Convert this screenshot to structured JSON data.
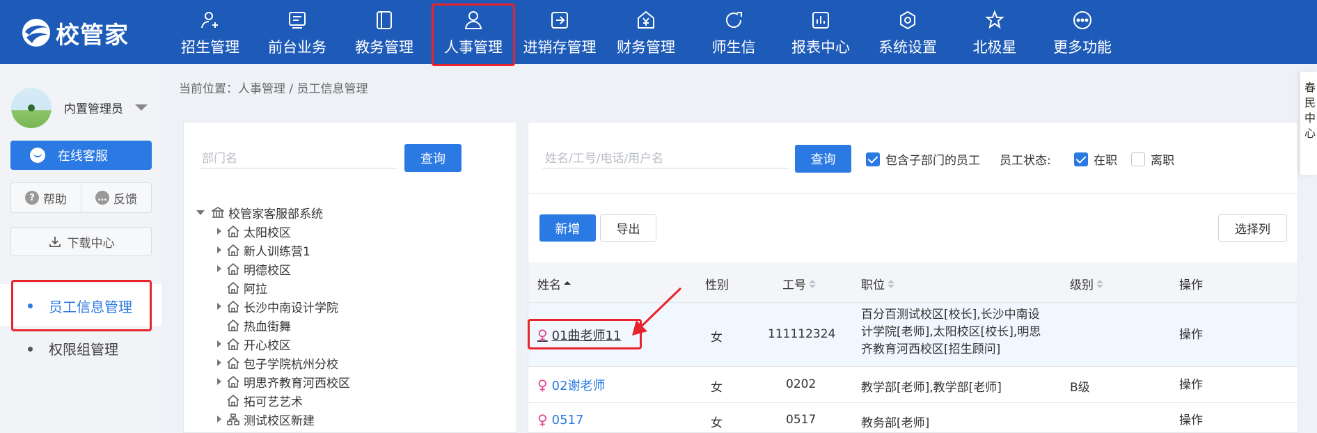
{
  "app": {
    "logo_text": "校管家"
  },
  "nav": [
    {
      "label": "招生管理",
      "icon": "user-plus-icon"
    },
    {
      "label": "前台业务",
      "icon": "monitor-icon"
    },
    {
      "label": "教务管理",
      "icon": "book-icon"
    },
    {
      "label": "人事管理",
      "icon": "person-icon",
      "active": true
    },
    {
      "label": "进销存管理",
      "icon": "inventory-icon"
    },
    {
      "label": "财务管理",
      "icon": "finance-icon"
    },
    {
      "label": "师生信",
      "icon": "message-icon"
    },
    {
      "label": "报表中心",
      "icon": "report-icon"
    },
    {
      "label": "系统设置",
      "icon": "settings-icon"
    },
    {
      "label": "北极星",
      "icon": "star-icon"
    },
    {
      "label": "更多功能",
      "icon": "more-icon"
    }
  ],
  "sidebar": {
    "user_name": "内置管理员",
    "online_service": "在线客服",
    "help": "帮助",
    "feedback": "反馈",
    "download": "下载中心",
    "menu": [
      {
        "label": "员工信息管理",
        "active": true
      },
      {
        "label": "权限组管理",
        "active": false
      }
    ]
  },
  "breadcrumb": "当前位置：人事管理 / 员工信息管理",
  "dept_panel": {
    "search_placeholder": "部门名",
    "query_button": "查询",
    "tree": {
      "root": "校管家客服部系统",
      "children": [
        {
          "label": "太阳校区",
          "expandable": true,
          "icon": "house-icon"
        },
        {
          "label": "新人训练营1",
          "expandable": true,
          "icon": "house-icon"
        },
        {
          "label": "明德校区",
          "expandable": true,
          "icon": "house-icon"
        },
        {
          "label": "阿拉",
          "expandable": false,
          "icon": "house-icon"
        },
        {
          "label": "长沙中南设计学院",
          "expandable": true,
          "icon": "house-icon"
        },
        {
          "label": "热血街舞",
          "expandable": false,
          "icon": "house-icon"
        },
        {
          "label": "开心校区",
          "expandable": true,
          "icon": "house-icon"
        },
        {
          "label": "包子学院杭州分校",
          "expandable": true,
          "icon": "house-icon"
        },
        {
          "label": "明思齐教育河西校区",
          "expandable": true,
          "icon": "house-icon"
        },
        {
          "label": "拓可艺艺术",
          "expandable": false,
          "icon": "house-icon"
        },
        {
          "label": "测试校区新建",
          "expandable": true,
          "icon": "org-icon"
        }
      ]
    }
  },
  "staff_panel": {
    "search_placeholder": "姓名/工号/电话/用户名",
    "query_button": "查询",
    "include_sub": {
      "label": "包含子部门的员工",
      "checked": true
    },
    "status_label": "员工状态:",
    "status_options": [
      {
        "label": "在职",
        "checked": true
      },
      {
        "label": "离职",
        "checked": false
      }
    ],
    "add_button": "新增",
    "export_button": "导出",
    "select_columns": "选择列",
    "columns": [
      "姓名",
      "性别",
      "工号",
      "职位",
      "级别",
      "操作"
    ],
    "rows": [
      {
        "name": "01曲老师11",
        "gender": "女",
        "id": "111112324",
        "position": "百分百测试校区[校长],长沙中南设计学院[老师],太阳校区[校长],明思齐教育河西校区[招生顾问]",
        "level": "",
        "action": "操作"
      },
      {
        "name": "02谢老师",
        "gender": "女",
        "id": "0202",
        "position": "教学部[老师],教学部[老师]",
        "level": "B级",
        "action": "操作"
      },
      {
        "name": "0517",
        "gender": "女",
        "id": "0517",
        "position": "教务部[老师]",
        "level": "",
        "action": "操作"
      }
    ]
  },
  "float_panel": {
    "text": "春民中心"
  },
  "colors": {
    "topbar": "#1e5bb8",
    "primary": "#2b7ae3",
    "highlight": "#e8232b",
    "female": "#e0488f"
  }
}
